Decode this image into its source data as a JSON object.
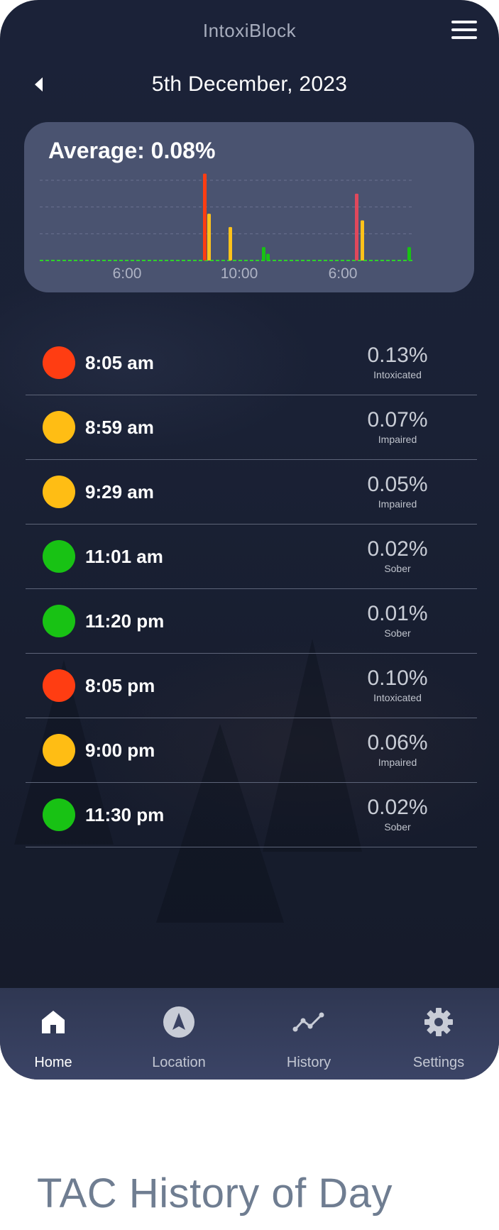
{
  "app": {
    "title": "IntoxiBlock"
  },
  "header": {
    "date": "5th December, 2023"
  },
  "summary": {
    "average_label": "Average: 0.08%"
  },
  "chart_data": {
    "type": "bar",
    "x_tick_labels": [
      "6:00",
      "10:00",
      "6:00"
    ],
    "y_gridlines": [
      0.04,
      0.08,
      0.12
    ],
    "threshold": 0.0,
    "ylim": [
      0,
      0.12
    ],
    "bars": [
      {
        "value": 0.13,
        "color": "#ff3d12"
      },
      {
        "value": 0.07,
        "color": "#ffc21a"
      },
      {
        "value": 0.05,
        "color": "#ffc21a"
      },
      {
        "value": 0.02,
        "color": "#18c214"
      },
      {
        "value": 0.01,
        "color": "#18c214"
      },
      {
        "value": 0.1,
        "color": "#e0485c"
      },
      {
        "value": 0.06,
        "color": "#ffc21a"
      },
      {
        "value": 0.02,
        "color": "#18c214"
      }
    ]
  },
  "readings": [
    {
      "time": "8:05 am",
      "value": "0.13%",
      "status": "Intoxicated",
      "color": "#ff3d12"
    },
    {
      "time": "8:59 am",
      "value": "0.07%",
      "status": "Impaired",
      "color": "#ffbd14"
    },
    {
      "time": "9:29 am",
      "value": "0.05%",
      "status": "Impaired",
      "color": "#ffbd14"
    },
    {
      "time": "11:01 am",
      "value": "0.02%",
      "status": "Sober",
      "color": "#18c214"
    },
    {
      "time": "11:20 pm",
      "value": "0.01%",
      "status": "Sober",
      "color": "#18c214"
    },
    {
      "time": "8:05 pm",
      "value": "0.10%",
      "status": "Intoxicated",
      "color": "#ff3d12"
    },
    {
      "time": "9:00 pm",
      "value": "0.06%",
      "status": "Impaired",
      "color": "#ffbd14"
    },
    {
      "time": "11:30 pm",
      "value": "0.02%",
      "status": "Sober",
      "color": "#18c214"
    }
  ],
  "nav": {
    "items": [
      {
        "label": "Home",
        "icon": "home-icon",
        "active": true
      },
      {
        "label": "Location",
        "icon": "navigation-icon",
        "active": false
      },
      {
        "label": "History",
        "icon": "trend-line-icon",
        "active": false
      },
      {
        "label": "Settings",
        "icon": "gear-icon",
        "active": false
      }
    ]
  },
  "caption": "TAC History of Day"
}
